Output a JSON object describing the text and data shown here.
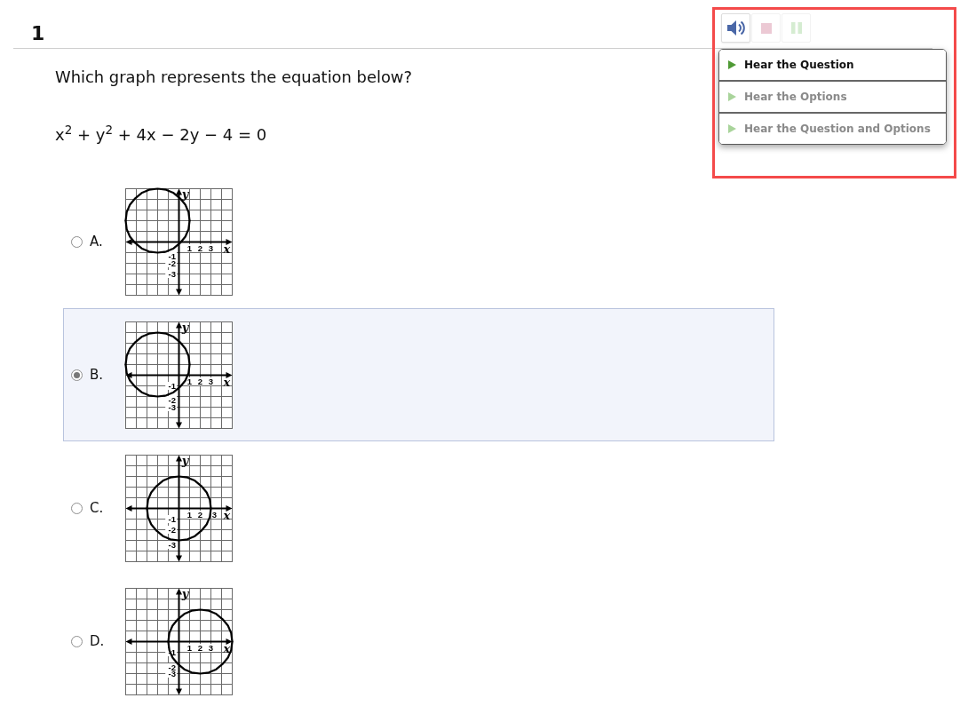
{
  "question": {
    "number": "1",
    "prompt": "Which graph represents the equation below?",
    "equation": "x$^{2}$ + y$^{2}$ + 4x − 2y − 4 = 0"
  },
  "toolbar": {
    "buttons": [
      {
        "kind": "speaker",
        "disabled": false
      },
      {
        "kind": "stop",
        "disabled": true
      },
      {
        "kind": "pause",
        "disabled": true
      }
    ]
  },
  "audio_menu": {
    "items": [
      {
        "label": "Hear the Question",
        "disabled": false
      },
      {
        "label": "Hear the Options",
        "disabled": true
      },
      {
        "label": "Hear the Question and Options",
        "disabled": true
      }
    ]
  },
  "options": [
    {
      "label": "A.",
      "selected": false,
      "chart_data": {
        "type": "line",
        "xlabel": "x",
        "ylabel": "y",
        "xlim": [
          -5,
          5
        ],
        "ylim": [
          -5,
          5
        ],
        "grid": true,
        "xticks": [
          {
            "value": 1,
            "label": "1"
          },
          {
            "value": 2,
            "label": "2"
          },
          {
            "value": 3,
            "label": "3"
          }
        ],
        "yticks": [
          {
            "value": -1,
            "label": "-1"
          },
          {
            "value": -2,
            "label": "-2"
          },
          {
            "value": -3,
            "label": "-3"
          }
        ],
        "x": [
          -5,
          -4.9,
          -4.6,
          -4.1,
          -3.5,
          -2.8,
          -2,
          -1.2,
          -0.5,
          0.1,
          0.6,
          0.9,
          1
        ],
        "series": [
          {
            "color": "#000000",
            "values": [
              2,
              2.8,
              3.5,
              4.1,
              4.6,
              4.9,
              5,
              4.9,
              4.6,
              4.1,
              3.5,
              2.8,
              2
            ]
          },
          {
            "color": "#000000",
            "values": [
              2,
              1.2,
              0.5,
              -0.1,
              -0.6,
              -0.9,
              -1,
              -0.9,
              -0.6,
              -0.1,
              0.5,
              1.2,
              2
            ]
          }
        ]
      }
    },
    {
      "label": "B.",
      "selected": true,
      "chart_data": {
        "type": "line",
        "xlabel": "x",
        "ylabel": "y",
        "xlim": [
          -5,
          5
        ],
        "ylim": [
          -5,
          5
        ],
        "grid": true,
        "xticks": [
          {
            "value": 1,
            "label": "1"
          },
          {
            "value": 2,
            "label": "2"
          },
          {
            "value": 3,
            "label": "3"
          }
        ],
        "yticks": [
          {
            "value": -1,
            "label": "-1"
          },
          {
            "value": -2,
            "label": "-2"
          },
          {
            "value": -3,
            "label": "-3"
          }
        ],
        "x": [
          -5,
          -4.9,
          -4.6,
          -4.1,
          -3.5,
          -2.8,
          -2,
          -1.2,
          -0.5,
          0.1,
          0.6,
          0.9,
          1
        ],
        "series": [
          {
            "color": "#000000",
            "values": [
              1,
              1.8,
              2.5,
              3.1,
              3.6,
              3.9,
              4,
              3.9,
              3.6,
              3.1,
              2.5,
              1.8,
              1
            ]
          },
          {
            "color": "#000000",
            "values": [
              1,
              0.2,
              -0.5,
              -1.1,
              -1.6,
              -1.9,
              -2,
              -1.9,
              -1.6,
              -1.1,
              -0.5,
              0.2,
              1
            ]
          }
        ]
      }
    },
    {
      "label": "C.",
      "selected": false,
      "chart_data": {
        "type": "line",
        "xlabel": "x",
        "ylabel": "y",
        "xlim": [
          -5,
          5
        ],
        "ylim": [
          -5,
          5
        ],
        "grid": true,
        "xticks": [
          {
            "value": 1,
            "label": "1"
          },
          {
            "value": 2,
            "label": "2"
          },
          {
            "value": 3,
            "label": "3"
          }
        ],
        "yticks": [
          {
            "value": -1,
            "label": "-1"
          },
          {
            "value": -2,
            "label": "-2"
          },
          {
            "value": -3,
            "label": "-3"
          }
        ],
        "x": [
          -3,
          -2.9,
          -2.6,
          -2.1,
          -1.5,
          -0.8,
          0,
          0.8,
          1.5,
          2.1,
          2.6,
          2.9,
          3
        ],
        "series": [
          {
            "color": "#000000",
            "values": [
              0,
              0.8,
              1.5,
              2.1,
              2.6,
              2.9,
              3,
              2.9,
              2.6,
              2.1,
              1.5,
              0.8,
              0
            ]
          },
          {
            "color": "#000000",
            "values": [
              0,
              -0.8,
              -1.5,
              -2.1,
              -2.6,
              -2.9,
              -3,
              -2.9,
              -2.6,
              -2.1,
              -1.5,
              -0.8,
              0
            ]
          }
        ]
      }
    },
    {
      "label": "D.",
      "selected": false,
      "chart_data": {
        "type": "line",
        "xlabel": "x",
        "ylabel": "y",
        "xlim": [
          -5,
          5
        ],
        "ylim": [
          -5,
          5
        ],
        "grid": true,
        "xticks": [
          {
            "value": 1,
            "label": "1"
          },
          {
            "value": 2,
            "label": "2"
          },
          {
            "value": 3,
            "label": "3"
          }
        ],
        "yticks": [
          {
            "value": -1,
            "label": "-1"
          },
          {
            "value": -2,
            "label": "-2"
          },
          {
            "value": -3,
            "label": "-3"
          }
        ],
        "x": [
          -1,
          -0.9,
          -0.6,
          -0.1,
          0.5,
          1.2,
          2,
          2.8,
          3.5,
          4.1,
          4.6,
          4.9,
          5
        ],
        "series": [
          {
            "color": "#000000",
            "values": [
              0,
              0.8,
              1.5,
              2.1,
              2.6,
              2.9,
              3,
              2.9,
              2.6,
              2.1,
              1.5,
              0.8,
              0
            ]
          },
          {
            "color": "#000000",
            "values": [
              0,
              -0.8,
              -1.5,
              -2.1,
              -2.6,
              -2.9,
              -3,
              -2.9,
              -2.6,
              -2.1,
              -1.5,
              -0.8,
              0
            ]
          }
        ]
      }
    }
  ]
}
